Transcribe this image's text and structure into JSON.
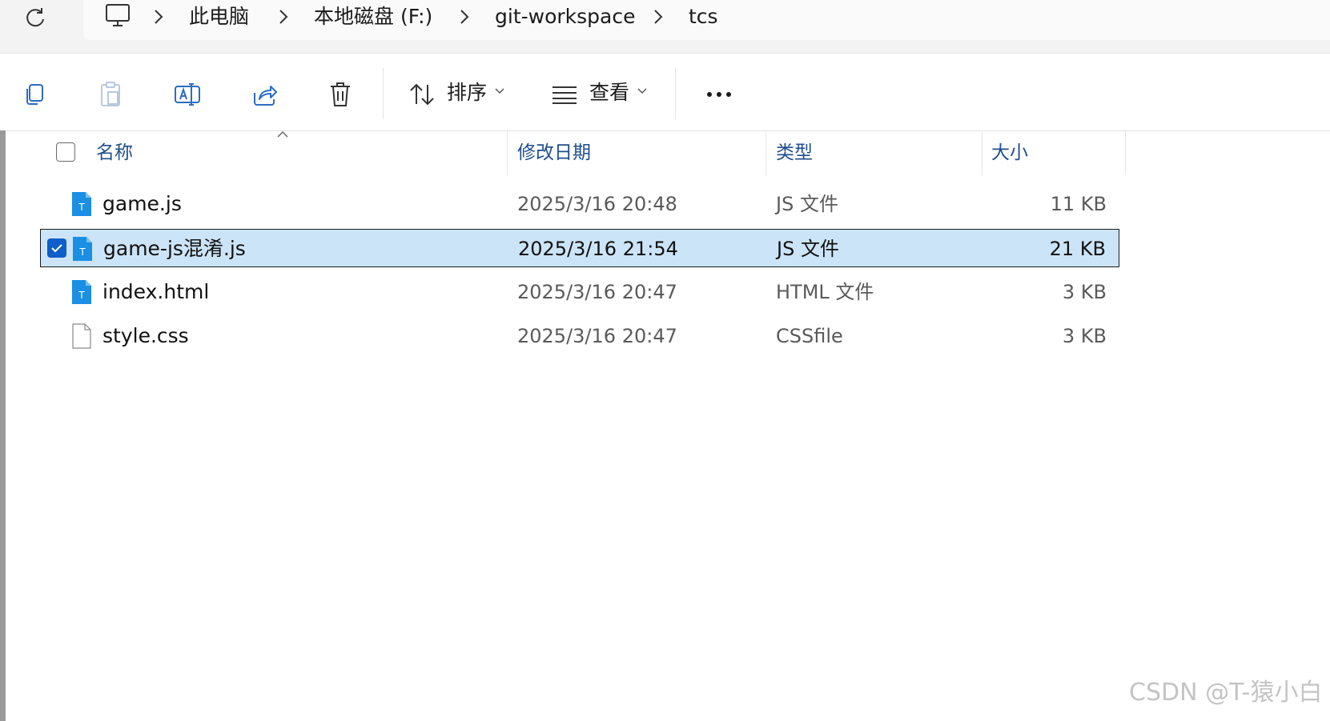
{
  "breadcrumb": {
    "items": [
      "此电脑",
      "本地磁盘 (F:)",
      "git-workspace",
      "tcs"
    ]
  },
  "toolbar": {
    "copy_icon": "copy-icon",
    "paste_icon": "paste-icon",
    "rename_icon": "rename-icon",
    "share_icon": "share-icon",
    "delete_icon": "delete-icon",
    "sort_label": "排序",
    "view_label": "查看",
    "more_icon": "more-icon"
  },
  "columns": {
    "name": "名称",
    "date": "修改日期",
    "type": "类型",
    "size": "大小"
  },
  "files": [
    {
      "name": "game.js",
      "date": "2025/3/16 20:48",
      "type": "JS 文件",
      "size": "11 KB",
      "icon": "js-file-icon",
      "selected": false
    },
    {
      "name": "game-js混淆.js",
      "date": "2025/3/16 21:54",
      "type": "JS 文件",
      "size": "21 KB",
      "icon": "js-file-icon",
      "selected": true
    },
    {
      "name": "index.html",
      "date": "2025/3/16 20:47",
      "type": "HTML 文件",
      "size": "3 KB",
      "icon": "html-file-icon",
      "selected": false
    },
    {
      "name": "style.css",
      "date": "2025/3/16 20:47",
      "type": "CSSfile",
      "size": "3 KB",
      "icon": "blank-file-icon",
      "selected": false
    }
  ],
  "colors": {
    "accent": "#0f5ec9",
    "selection": "#cce4f7",
    "header_text": "#1f4e8c",
    "file_icon_blue": "#1a8fe3"
  },
  "watermark": "CSDN @T-猿小白"
}
